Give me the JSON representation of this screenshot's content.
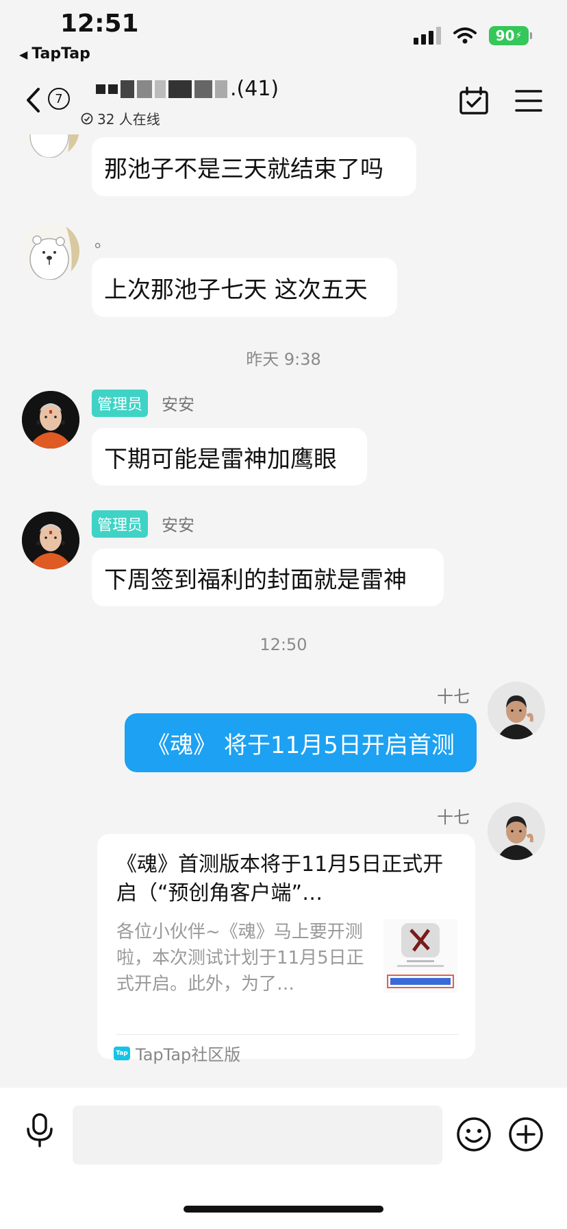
{
  "status_bar": {
    "time": "12:51",
    "back_app": "TapTap",
    "battery": "90"
  },
  "header": {
    "unread_count": "7",
    "title_suffix": ".(41)",
    "online": "32 人在线"
  },
  "messages": [
    {
      "text": "那池子不是三天就结束了吗"
    },
    {
      "sender": "。",
      "text": "上次那池子七天 这次五天"
    },
    {
      "timestamp": "昨天 9:38"
    },
    {
      "badge": "管理员",
      "sender": "安安",
      "text": "下期可能是雷神加鹰眼"
    },
    {
      "badge": "管理员",
      "sender": "安安",
      "text": "下周签到福利的封面就是雷神"
    },
    {
      "timestamp": "12:50"
    },
    {
      "sender": "十七",
      "text": "《魂》 将于11月5日开启首测"
    },
    {
      "sender": "十七"
    }
  ],
  "card": {
    "title": "《魂》首测版本将于11月5日正式开启（“预创角客户端”…",
    "description": "各位小伙伴~《魂》马上要开测啦，本次测试计划于11月5日正式开启。此外，为了…",
    "source": "TapTap社区版",
    "source_logo": "Tap"
  },
  "input": {
    "placeholder": ""
  },
  "colors": {
    "accent_blue": "#1da1f2",
    "badge_teal": "#3fd3c6",
    "battery_green": "#34c759"
  }
}
